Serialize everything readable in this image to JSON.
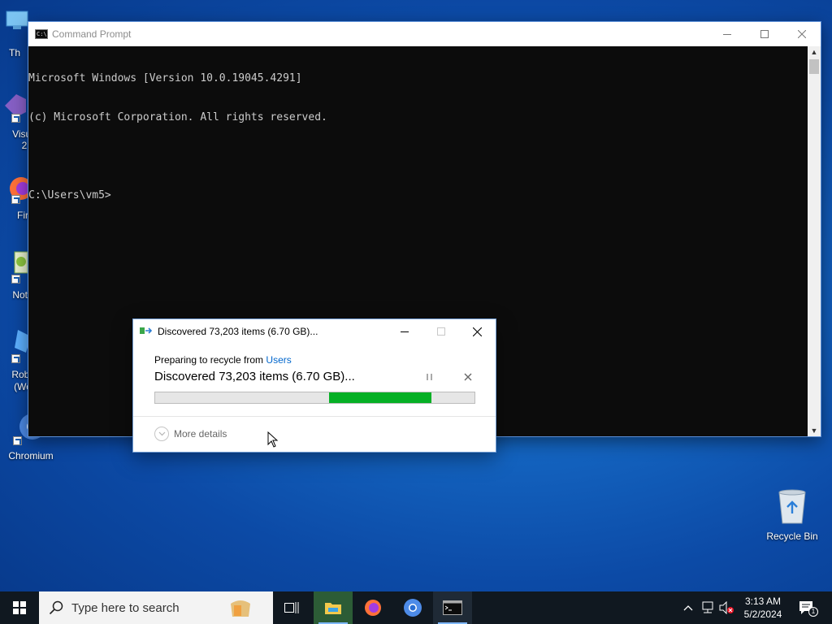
{
  "desktop": {
    "icons": [
      {
        "name": "this-pc",
        "label": "Th"
      },
      {
        "name": "visual-studio",
        "label": "Visua"
      },
      {
        "name": "visual-studio-2",
        "label": "2"
      },
      {
        "name": "firefox",
        "label": "Fir"
      },
      {
        "name": "notepad-plus",
        "label": "Note"
      },
      {
        "name": "roblox",
        "label": "Roblo"
      },
      {
        "name": "roblox-2",
        "label": "(Wor"
      },
      {
        "name": "chromium",
        "label": "Chromium"
      }
    ],
    "recycle_bin": {
      "label": "Recycle Bin"
    }
  },
  "cmd": {
    "title": "Command Prompt",
    "icon_text": "C:\\",
    "lines": [
      "Microsoft Windows [Version 10.0.19045.4291]",
      "(c) Microsoft Corporation. All rights reserved.",
      "",
      "C:\\Users\\vm5>"
    ]
  },
  "dialog": {
    "title": "Discovered 73,203 items (6.70 GB)...",
    "subtitle_prefix": "Preparing to recycle from",
    "subtitle_link": "Users",
    "status": "Discovered 73,203 items (6.70 GB)...",
    "more_details": "More details",
    "progress": {
      "start_fraction": 0.545,
      "end_fraction": 0.865,
      "color": "#06b025"
    }
  },
  "taskbar": {
    "search_placeholder": "Type here to search",
    "time": "3:13 AM",
    "date": "5/2/2024",
    "notification_count": "1"
  },
  "colors": {
    "accent": "#0078d7",
    "progress_green": "#06b025",
    "console_text": "#cccccc",
    "console_bg": "#0c0c0c"
  }
}
